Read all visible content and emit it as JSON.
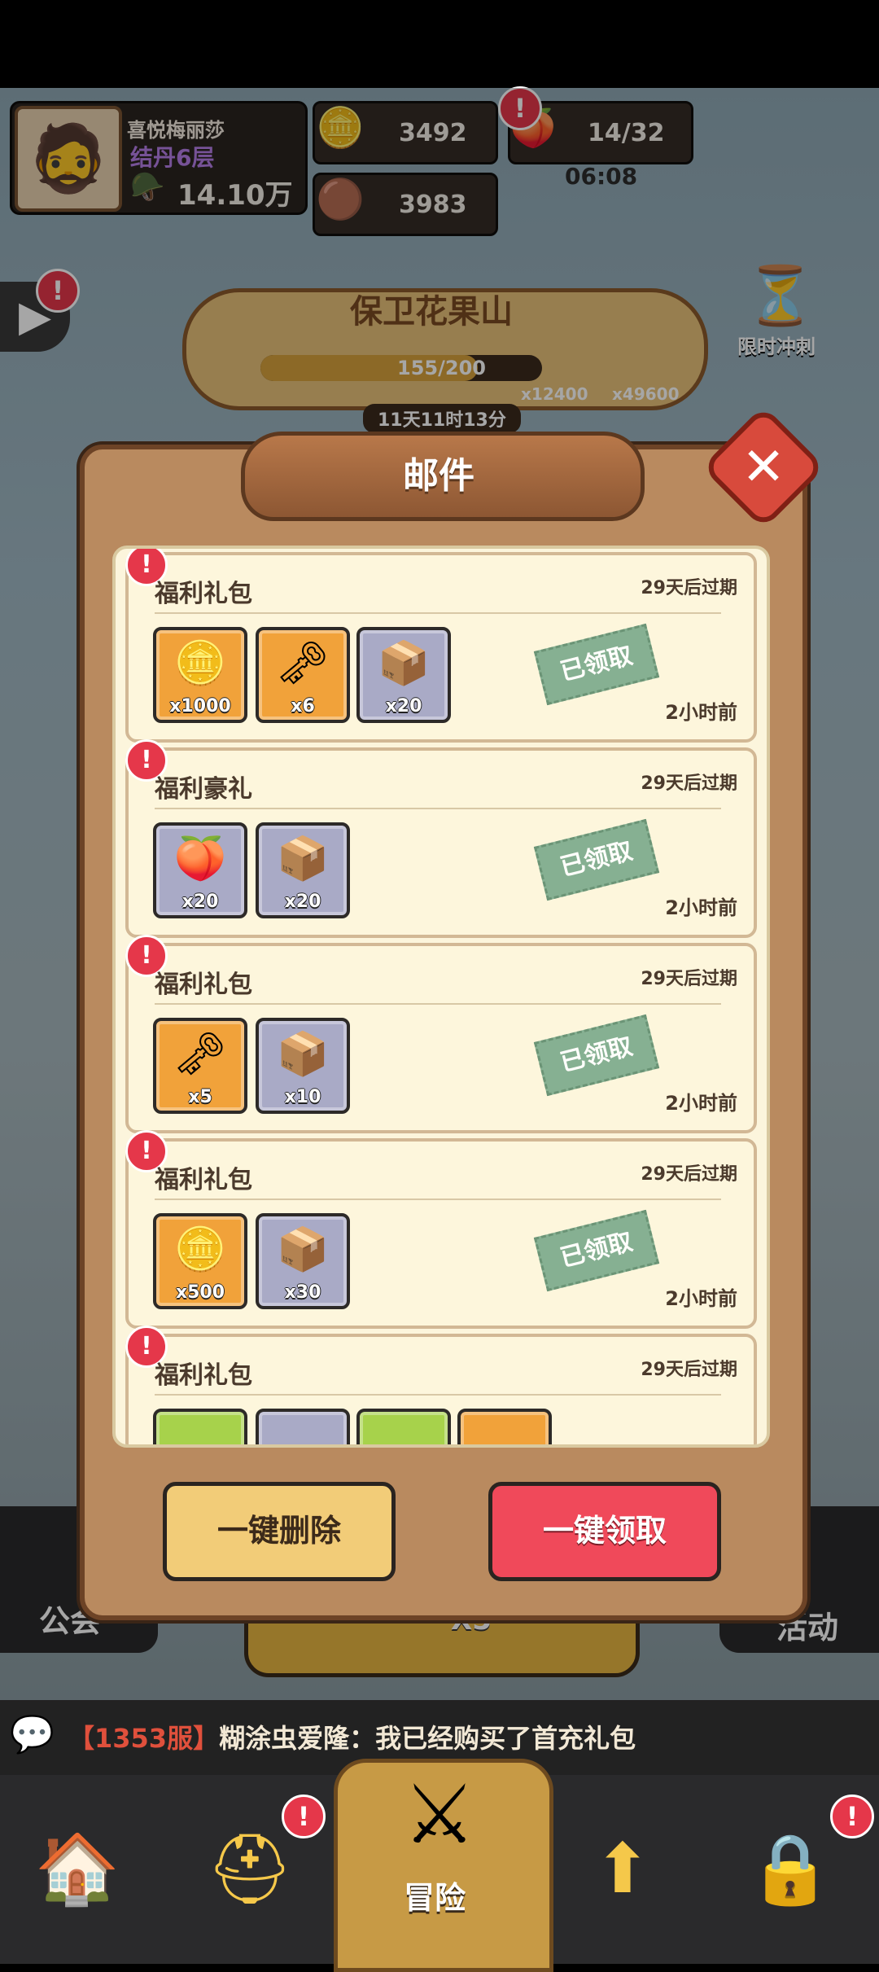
{
  "player": {
    "name": "喜悦梅丽莎",
    "realm": "结丹6层",
    "power": "14.10万"
  },
  "resources": {
    "gold": "3492",
    "coins": "3983",
    "stamina": "14/32",
    "stamina_timer": "06:08"
  },
  "event": {
    "title": "保卫花果山",
    "progress": "155/200",
    "reward_a": "x12400",
    "reward_b": "x49600",
    "countdown": "11天11时13分",
    "limited_sprint": "限时冲刺"
  },
  "dialog": {
    "title": "邮件",
    "claimed_stamp": "已领取",
    "delete_all": "一键删除",
    "claim_all": "一键领取"
  },
  "mails": [
    {
      "title": "福利礼包",
      "expiry": "29天后过期",
      "time": "2小时前",
      "items": [
        {
          "icon": "gold-ingot-icon",
          "count": "x1000"
        },
        {
          "icon": "key-icon",
          "count": "x6"
        },
        {
          "icon": "treasure-chest-icon",
          "count": "x20"
        }
      ]
    },
    {
      "title": "福利豪礼",
      "expiry": "29天后过期",
      "time": "2小时前",
      "items": [
        {
          "icon": "peach-icon",
          "count": "x20"
        },
        {
          "icon": "treasure-chest-icon",
          "count": "x20"
        }
      ]
    },
    {
      "title": "福利礼包",
      "expiry": "29天后过期",
      "time": "2小时前",
      "items": [
        {
          "icon": "key-icon",
          "count": "x5"
        },
        {
          "icon": "treasure-chest-icon",
          "count": "x10"
        }
      ]
    },
    {
      "title": "福利礼包",
      "expiry": "29天后过期",
      "time": "2小时前",
      "items": [
        {
          "icon": "gold-ingot-icon",
          "count": "x500"
        },
        {
          "icon": "treasure-chest-icon",
          "count": "x30"
        }
      ]
    },
    {
      "title": "福利礼包",
      "expiry": "29天后过期"
    }
  ],
  "background_labels": {
    "guild": "公会",
    "activity": "活动",
    "peach_count": "X5"
  },
  "chat": {
    "server": "【1353服】",
    "message": "糊涂虫爱隆：我已经购买了首充礼包"
  },
  "nav": {
    "adventure": "冒险"
  },
  "badge_mark": "!",
  "colors": {
    "dialog_bg": "#b98a5f",
    "claim_button": "#f0495a",
    "delete_button": "#f2cc78",
    "stamp": "#7aa98a"
  }
}
